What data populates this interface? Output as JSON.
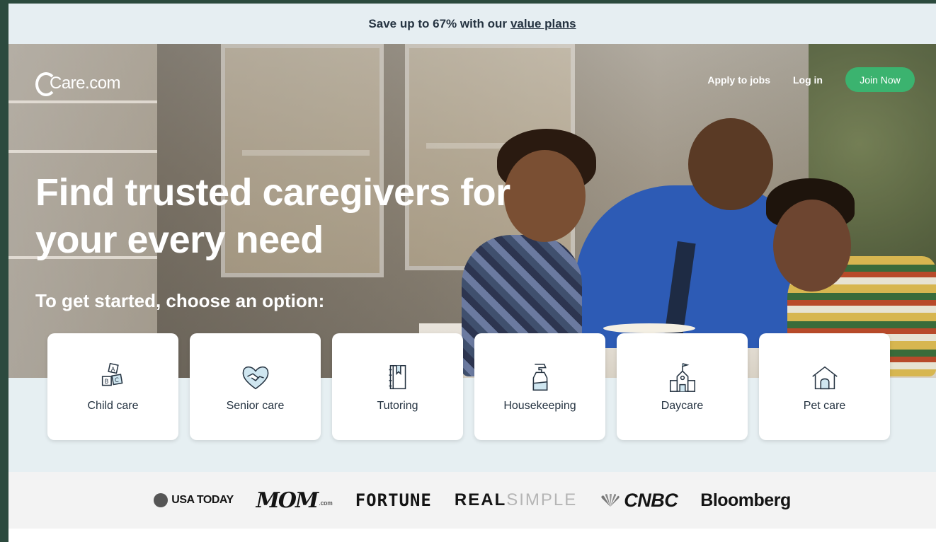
{
  "promo": {
    "text": "Save up to 67% with our",
    "link": "value plans"
  },
  "header": {
    "logo": "Care.com",
    "nav": {
      "apply": "Apply to jobs",
      "login": "Log in",
      "join": "Join Now"
    }
  },
  "hero": {
    "headline": "Find trusted caregivers for your every need",
    "subhead": "To get started, choose an option:"
  },
  "options": [
    {
      "label": "Child care",
      "icon": "abc-blocks-icon"
    },
    {
      "label": "Senior care",
      "icon": "heart-hands-icon"
    },
    {
      "label": "Tutoring",
      "icon": "notebook-icon"
    },
    {
      "label": "Housekeeping",
      "icon": "spray-bottle-icon"
    },
    {
      "label": "Daycare",
      "icon": "schoolhouse-icon"
    },
    {
      "label": "Pet care",
      "icon": "doghouse-icon"
    }
  ],
  "press": {
    "usatoday": "USA TODAY",
    "mom": "MOM",
    "mom_suffix": ".com",
    "fortune": "FORTUNE",
    "real": "REAL",
    "simple": "SIMPLE",
    "cnbc": "CNBC",
    "bloomberg": "Bloomberg"
  },
  "colors": {
    "accent": "#3bb36f",
    "promo_bg": "#e6eef2",
    "text_dark": "#253341"
  }
}
